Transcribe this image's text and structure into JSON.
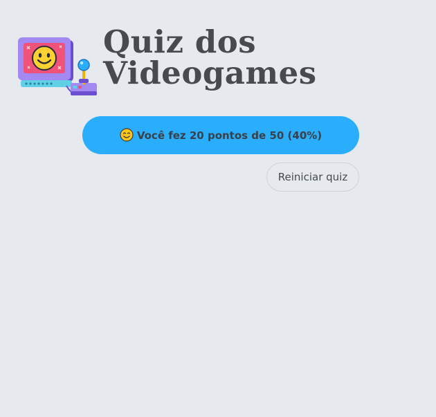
{
  "header": {
    "title": "Quiz dos Videogames",
    "logo_icon": "retro-computer-joystick-icon"
  },
  "result": {
    "emoji_icon": "smiling-face-icon",
    "text": "Você fez 20 pontos de 50 (40%)"
  },
  "actions": {
    "restart_label": "Reiniciar quiz"
  },
  "colors": {
    "background": "#e6e9ed",
    "accent": "#2aaefc",
    "title": "#474b50"
  }
}
